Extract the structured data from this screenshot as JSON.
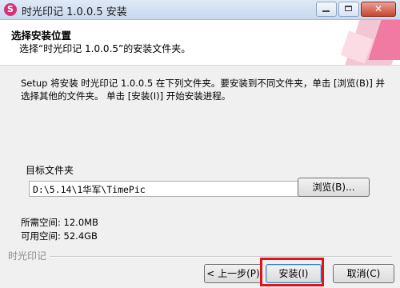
{
  "window": {
    "title": "时光印记 1.0.0.5 安装",
    "icon_letter": "S"
  },
  "header": {
    "title": "选择安装位置",
    "subtitle": "选择“时光印记 1.0.0.5”的安装文件夹。"
  },
  "description": "Setup 将安装 时光印记 1.0.0.5 在下列文件夹。要安装到不同文件夹，单击 [浏览(B)] 并选择其他的文件夹。 单击 [安装(I)] 开始安装进程。",
  "destination": {
    "label": "目标文件夹",
    "path": "D:\\5.14\\1华军\\TimePic",
    "browse_label": "浏览(B)..."
  },
  "space": {
    "required": "所需空间: 12.0MB",
    "available": "可用空间: 52.4GB"
  },
  "footer": {
    "brand": "时光印记",
    "back_label": "< 上一步(P)",
    "install_label": "安装(I)",
    "cancel_label": "取消(C)"
  },
  "colors": {
    "highlight": "#e0141a",
    "icon_bg": "#d6317a"
  }
}
